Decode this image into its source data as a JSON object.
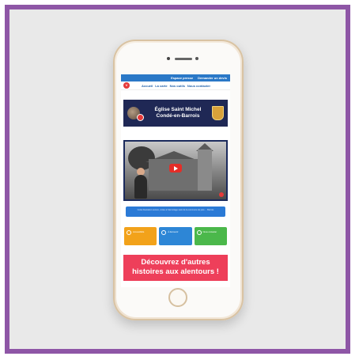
{
  "topbar": {
    "links": [
      "Espace presse",
      "Demander un devis"
    ]
  },
  "nav": {
    "logo_text": "V",
    "links": [
      "Accueil",
      "La carte",
      "Nos outils",
      "Nous contacter"
    ]
  },
  "header": {
    "title_line1": "Église Saint Michel",
    "title_line2": "Condé-en-Barrois"
  },
  "video": {
    "play_icon": "play-icon"
  },
  "info": {
    "text": "Cette illustration sonore, créée à l'Hermitage vient de la commune de puis ... Barrois"
  },
  "cards": [
    {
      "label": "Accessibilité",
      "color": "#f2a21a"
    },
    {
      "label": "À découvrir",
      "color": "#2d86d6"
    },
    {
      "label": "Nous contacter",
      "color": "#4bb84b"
    }
  ],
  "cta": {
    "line1": "Découvrez d'autres",
    "line2": "histoires aux alentours !"
  },
  "colors": {
    "frame": "#8e56a6",
    "header": "#1f2855",
    "topbar": "#2a78c7",
    "cta": "#ee3f5a"
  }
}
